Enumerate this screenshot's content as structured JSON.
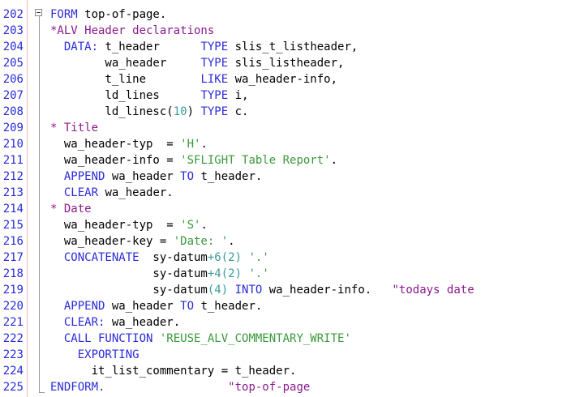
{
  "editor": {
    "lines": [
      {
        "n": "202",
        "tokens": [
          {
            "t": "kw",
            "v": "FORM"
          },
          {
            "t": "pl",
            "v": " top-of-page."
          }
        ]
      },
      {
        "n": "203",
        "tokens": [
          {
            "t": "cm",
            "v": "*ALV Header declarations"
          }
        ]
      },
      {
        "n": "204",
        "tokens": [
          {
            "t": "pl",
            "v": "  "
          },
          {
            "t": "kw",
            "v": "DATA:"
          },
          {
            "t": "pl",
            "v": " t_header      "
          },
          {
            "t": "kw",
            "v": "TYPE"
          },
          {
            "t": "pl",
            "v": " slis_t_listheader,"
          }
        ]
      },
      {
        "n": "205",
        "tokens": [
          {
            "t": "pl",
            "v": "        wa_header     "
          },
          {
            "t": "kw",
            "v": "TYPE"
          },
          {
            "t": "pl",
            "v": " slis_listheader,"
          }
        ]
      },
      {
        "n": "206",
        "tokens": [
          {
            "t": "pl",
            "v": "        t_line        "
          },
          {
            "t": "kw",
            "v": "LIKE"
          },
          {
            "t": "pl",
            "v": " wa_header-info,"
          }
        ]
      },
      {
        "n": "207",
        "tokens": [
          {
            "t": "pl",
            "v": "        ld_lines      "
          },
          {
            "t": "kw",
            "v": "TYPE"
          },
          {
            "t": "pl",
            "v": " i,"
          }
        ]
      },
      {
        "n": "208",
        "tokens": [
          {
            "t": "pl",
            "v": "        ld_linesc("
          },
          {
            "t": "num",
            "v": "10"
          },
          {
            "t": "pl",
            "v": ") "
          },
          {
            "t": "kw",
            "v": "TYPE"
          },
          {
            "t": "pl",
            "v": " c."
          }
        ]
      },
      {
        "n": "209",
        "tokens": [
          {
            "t": "cm",
            "v": "* Title"
          }
        ]
      },
      {
        "n": "210",
        "tokens": [
          {
            "t": "pl",
            "v": "  wa_header-typ  = "
          },
          {
            "t": "str",
            "v": "'H'"
          },
          {
            "t": "pl",
            "v": "."
          }
        ]
      },
      {
        "n": "211",
        "tokens": [
          {
            "t": "pl",
            "v": "  wa_header-info = "
          },
          {
            "t": "str",
            "v": "'SFLIGHT Table Report'"
          },
          {
            "t": "pl",
            "v": "."
          }
        ]
      },
      {
        "n": "212",
        "tokens": [
          {
            "t": "pl",
            "v": "  "
          },
          {
            "t": "kw",
            "v": "APPEND"
          },
          {
            "t": "pl",
            "v": " wa_header "
          },
          {
            "t": "kw",
            "v": "TO"
          },
          {
            "t": "pl",
            "v": " t_header."
          }
        ]
      },
      {
        "n": "213",
        "tokens": [
          {
            "t": "pl",
            "v": "  "
          },
          {
            "t": "kw",
            "v": "CLEAR"
          },
          {
            "t": "pl",
            "v": " wa_header."
          }
        ]
      },
      {
        "n": "214",
        "tokens": [
          {
            "t": "cm",
            "v": "* Date"
          }
        ]
      },
      {
        "n": "215",
        "tokens": [
          {
            "t": "pl",
            "v": "  wa_header-typ  = "
          },
          {
            "t": "str",
            "v": "'S'"
          },
          {
            "t": "pl",
            "v": "."
          }
        ]
      },
      {
        "n": "216",
        "tokens": [
          {
            "t": "pl",
            "v": "  wa_header-key = "
          },
          {
            "t": "str",
            "v": "'Date: '"
          },
          {
            "t": "pl",
            "v": "."
          }
        ]
      },
      {
        "n": "217",
        "tokens": [
          {
            "t": "pl",
            "v": "  "
          },
          {
            "t": "kw",
            "v": "CONCATENATE"
          },
          {
            "t": "pl",
            "v": "  sy-datum"
          },
          {
            "t": "num",
            "v": "+6(2)"
          },
          {
            "t": "pl",
            "v": " "
          },
          {
            "t": "str",
            "v": "'.'"
          }
        ]
      },
      {
        "n": "218",
        "tokens": [
          {
            "t": "pl",
            "v": "               sy-datum"
          },
          {
            "t": "num",
            "v": "+4(2)"
          },
          {
            "t": "pl",
            "v": " "
          },
          {
            "t": "str",
            "v": "'.'"
          }
        ]
      },
      {
        "n": "219",
        "tokens": [
          {
            "t": "pl",
            "v": "               sy-datum"
          },
          {
            "t": "num",
            "v": "(4)"
          },
          {
            "t": "pl",
            "v": " "
          },
          {
            "t": "kw",
            "v": "INTO"
          },
          {
            "t": "pl",
            "v": " wa_header-info.   "
          },
          {
            "t": "cm",
            "v": "\"todays date"
          }
        ]
      },
      {
        "n": "220",
        "tokens": [
          {
            "t": "pl",
            "v": "  "
          },
          {
            "t": "kw",
            "v": "APPEND"
          },
          {
            "t": "pl",
            "v": " wa_header "
          },
          {
            "t": "kw",
            "v": "TO"
          },
          {
            "t": "pl",
            "v": " t_header."
          }
        ]
      },
      {
        "n": "221",
        "tokens": [
          {
            "t": "pl",
            "v": "  "
          },
          {
            "t": "kw",
            "v": "CLEAR:"
          },
          {
            "t": "pl",
            "v": " wa_header."
          }
        ]
      },
      {
        "n": "222",
        "tokens": [
          {
            "t": "pl",
            "v": "  "
          },
          {
            "t": "kw",
            "v": "CALL FUNCTION"
          },
          {
            "t": "pl",
            "v": " "
          },
          {
            "t": "str",
            "v": "'REUSE_ALV_COMMENTARY_WRITE'"
          }
        ]
      },
      {
        "n": "223",
        "tokens": [
          {
            "t": "pl",
            "v": "    "
          },
          {
            "t": "kw",
            "v": "EXPORTING"
          }
        ]
      },
      {
        "n": "224",
        "tokens": [
          {
            "t": "pl",
            "v": "      it_list_commentary = t_header."
          }
        ]
      },
      {
        "n": "225",
        "tokens": [
          {
            "t": "kw",
            "v": "ENDFORM."
          },
          {
            "t": "pl",
            "v": "                  "
          },
          {
            "t": "cm",
            "v": "\"top-of-page"
          }
        ]
      }
    ],
    "colors": {
      "keyword": "#2b2bd9",
      "comment": "#8b1a8b",
      "string": "#3a9a3a",
      "number": "#3a9a9a",
      "line_number": "#2b2bd9",
      "text": "#000000"
    }
  }
}
